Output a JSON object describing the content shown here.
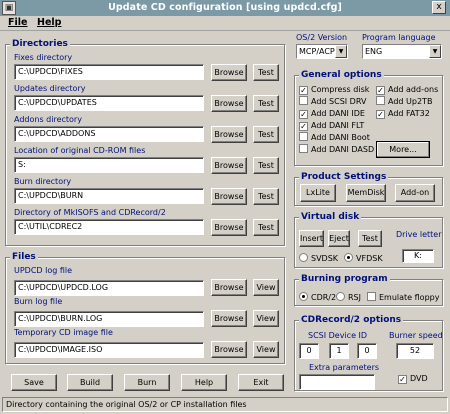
{
  "window": {
    "title": "Update CD configuration [using updcd.cfg]",
    "close": "x"
  },
  "menu": [
    "File",
    "Help"
  ],
  "directories": {
    "title": "Directories",
    "rows": [
      {
        "label": "Fixes directory",
        "value": "C:\\UPDCD\\FIXES",
        "browse": "Browse",
        "test": "Test"
      },
      {
        "label": "Updates directory",
        "value": "C:\\UPDCD\\UPDATES",
        "browse": "Browse",
        "test": "Test"
      },
      {
        "label": "Addons directory",
        "value": "C:\\UPDCD\\ADDONS",
        "browse": "Browse",
        "test": "Test"
      },
      {
        "label": "Location of original CD-ROM files",
        "value": "S:",
        "browse": "Browse",
        "test": "Test"
      },
      {
        "label": "Burn directory",
        "value": "C:\\UPDCD\\BURN",
        "browse": "Browse",
        "test": "Test"
      },
      {
        "label": "Directory of MkISOFS and CDRecord/2",
        "value": "C:\\UTIL\\CDREC2",
        "browse": "Browse",
        "test": "Test"
      }
    ]
  },
  "files": {
    "title": "Files",
    "rows": [
      {
        "label": "UPDCD log file",
        "value": "C:\\UPDCD\\UPDCD.LOG",
        "browse": "Browse",
        "view": "View"
      },
      {
        "label": "Burn log file",
        "value": "C:\\UPDCD\\BURN.LOG",
        "browse": "Browse",
        "view": "View"
      },
      {
        "label": "Temporary CD image file",
        "value": "C:\\UPDCD\\IMAGE.ISO",
        "browse": "Browse",
        "view": "View"
      }
    ]
  },
  "buttons": {
    "save": "Save",
    "build": "Build",
    "burn": "Burn",
    "help": "Help",
    "exit": "Exit"
  },
  "os2": {
    "label": "OS/2 Version",
    "value": "MCP/ACP"
  },
  "lang": {
    "label": "Program language",
    "value": "ENG"
  },
  "general": {
    "title": "General options",
    "left": [
      {
        "label": "Compress disk",
        "checked": true
      },
      {
        "label": "Add SCSI DRV",
        "checked": false
      },
      {
        "label": "Add DANI IDE",
        "checked": true
      },
      {
        "label": "Add DANI FLT",
        "checked": true
      },
      {
        "label": "Add DANI Boot",
        "checked": false
      },
      {
        "label": "Add DANI DASD",
        "checked": false
      }
    ],
    "right": [
      {
        "label": "Add add-ons",
        "checked": true
      },
      {
        "label": "Add Up2TB",
        "checked": false
      },
      {
        "label": "Add FAT32",
        "checked": true
      }
    ],
    "more": "More..."
  },
  "product": {
    "title": "Product Settings",
    "lxlite": "LxLite",
    "memdisk": "MemDisk",
    "addon": "Add-on"
  },
  "vdisk": {
    "title": "Virtual disk",
    "insert": "Insert",
    "eject": "Eject",
    "test": "Test",
    "drive_label": "Drive letter",
    "drive": "K:",
    "svdsk": "SVDSK",
    "vfdsk": "VFDSK"
  },
  "burning": {
    "title": "Burning program",
    "cdr2": "CDR/2",
    "rsj": "RSJ",
    "emulate": "Emulate floppy"
  },
  "cdrecord": {
    "title": "CDRecord/2 options",
    "scsi_label": "SCSI Device ID",
    "scsi": [
      "0",
      "1",
      "0"
    ],
    "speed_label": "Burner speed",
    "speed": "52",
    "extra_label": "Extra parameters",
    "extra": "",
    "dvd": "DVD"
  },
  "status": "Directory containing the original OS/2 or CP installation files",
  "colors": {
    "label_blue": "#00107a",
    "title_bar": "#7b9aa6"
  }
}
